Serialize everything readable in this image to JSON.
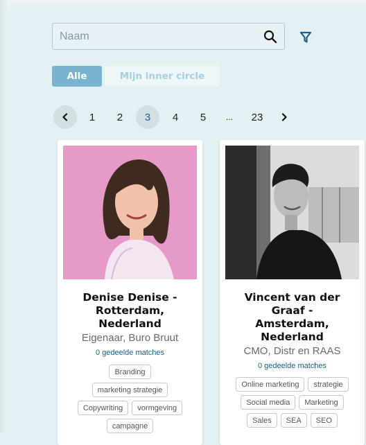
{
  "search": {
    "placeholder": "Naam",
    "value": ""
  },
  "tabs": [
    {
      "label": "Alle",
      "active": true
    },
    {
      "label": "Mijn inner circle",
      "active": false
    }
  ],
  "pagination": {
    "prev_icon": "chevron-left-icon",
    "next_icon": "chevron-right-icon",
    "pages": [
      "1",
      "2",
      "3",
      "4",
      "5",
      "...",
      "23"
    ],
    "current": "3"
  },
  "icons": {
    "search": "search-icon",
    "filter": "filter-icon"
  },
  "colors": {
    "accent": "#78b4cf",
    "link": "#1d5f84",
    "background": "#e3f0f4"
  },
  "profiles": [
    {
      "name_lines": [
        "Denise Denise -",
        "Rotterdam,",
        "Nederland"
      ],
      "role": "Eigenaar, Buro Bruut",
      "matches": "0 gedeelde matches",
      "tag_rows": [
        [
          "Branding"
        ],
        [
          "marketing strategie"
        ],
        [
          "Copywriting",
          "vormgeving"
        ],
        [
          "campagne"
        ]
      ]
    },
    {
      "name_lines": [
        "Vincent van der",
        "Graaf -",
        "Amsterdam,",
        "Nederland"
      ],
      "role": "CMO, Distr en RAAS",
      "matches": "0 gedeelde matches",
      "tag_rows": [
        [
          "Online marketing",
          "strategie"
        ],
        [
          "Social media",
          "Marketing"
        ],
        [
          "Sales",
          "SEA",
          "SEO"
        ]
      ]
    }
  ]
}
